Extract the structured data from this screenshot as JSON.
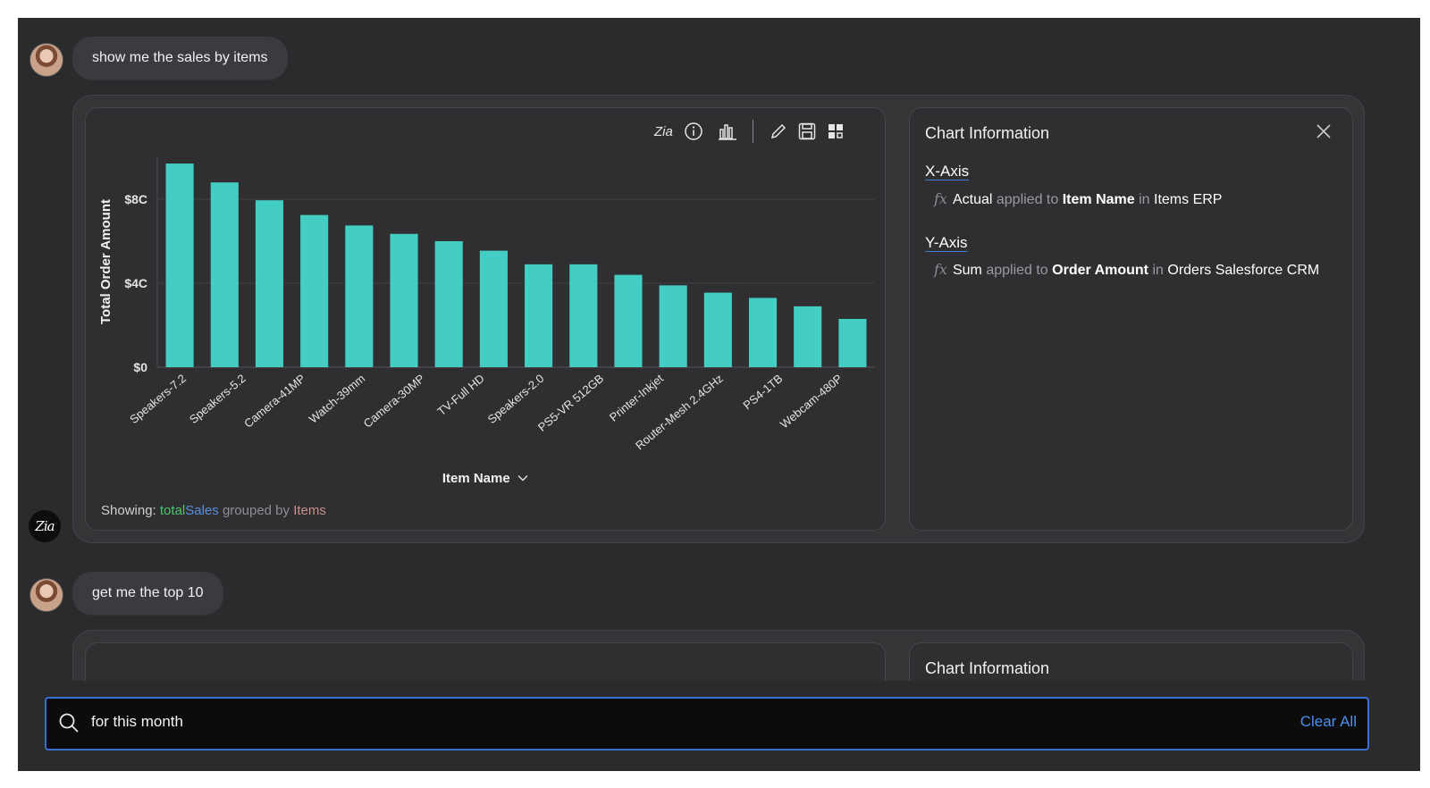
{
  "conversation": {
    "messages": [
      {
        "role": "user",
        "text": "show me the sales by items"
      },
      {
        "role": "user",
        "text": "get me the top 10"
      }
    ]
  },
  "bot": {
    "logo_text": "Zia"
  },
  "toolbar": {
    "icons": [
      "zia-icon",
      "info-icon",
      "bar-chart-icon",
      "edit-icon",
      "save-icon",
      "dashboard-grid-icon"
    ]
  },
  "chart_data": {
    "type": "bar",
    "categories": [
      "Speakers-7.2",
      "Speakers-5.2",
      "Camera-41MP",
      "Watch-39mm",
      "Camera-30MP",
      "TV-Full HD",
      "Speakers-2.0",
      "PS5-VR 512GB",
      "Printer-Inkjet",
      "Router-Mesh 2.4GHz",
      "PS4-1TB",
      "Webcam-480P",
      "",
      "",
      "",
      ""
    ],
    "visible_labels": [
      "Speakers-7.2",
      "Speakers-5.2",
      "Camera-41MP",
      "Watch-39mm",
      "Camera-30MP",
      "TV-Full HD",
      "Speakers-2.0",
      "PS5-VR 512GB",
      "Printer-Inkjet",
      "Router-Mesh 2.4GHz",
      "PS4-1TB",
      "Webcam-480P"
    ],
    "label_every": 1,
    "values": [
      97,
      88,
      79.5,
      72.5,
      67.5,
      63.5,
      60,
      55.5,
      49,
      49,
      44,
      39,
      35.5,
      33,
      29,
      23
    ],
    "yticks": [
      "$0",
      "$4C",
      "$8C"
    ],
    "ytick_values": [
      0,
      40,
      80
    ],
    "ylim": [
      0,
      100
    ],
    "ylabel": "Total Order Amount",
    "xlabel": "Item Name",
    "bar_color": "#43cdc3",
    "grid": true
  },
  "showing": {
    "prefix": "Showing:",
    "agg": "total",
    "measure": "Sales",
    "grouped": "grouped by",
    "dimension": "Items"
  },
  "chart_info": {
    "title": "Chart Information",
    "x_axis": {
      "heading": "X-Axis",
      "fx": "fx",
      "func": "Actual",
      "applied": "applied to",
      "field": "Item Name",
      "in": "in",
      "table": "Items",
      "source": "ERP"
    },
    "y_axis": {
      "heading": "Y-Axis",
      "fx": "fx",
      "func": "Sum",
      "applied": "applied to",
      "field": "Order Amount",
      "in": "in",
      "table": "Orders",
      "source": "Salesforce CRM"
    }
  },
  "second_card": {
    "info_title": "Chart Information"
  },
  "search": {
    "value": "for this month",
    "clear_label": "Clear All"
  }
}
